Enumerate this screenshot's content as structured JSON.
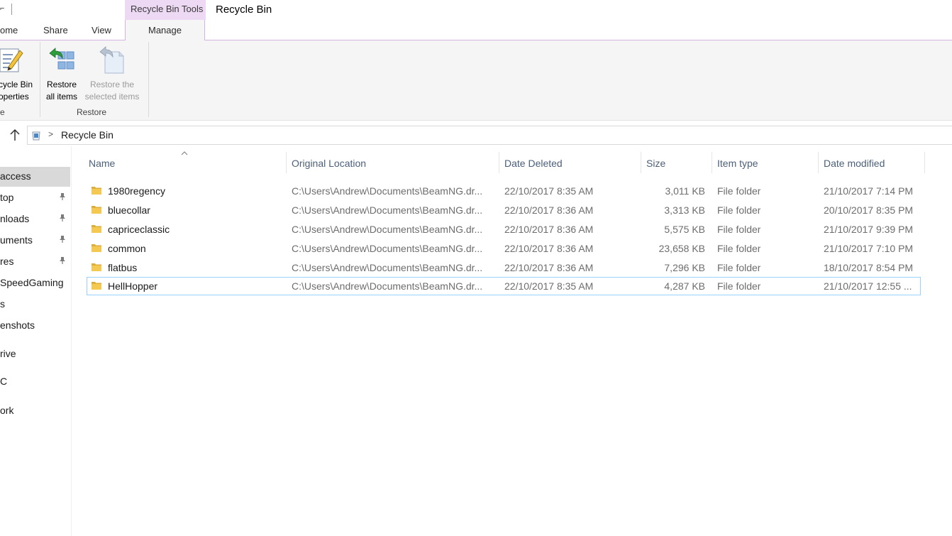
{
  "titlebar": {
    "context_tab_label": "Recycle Bin Tools",
    "window_title": "Recycle Bin"
  },
  "tabs": [
    {
      "label": "ome"
    },
    {
      "label": "Share"
    },
    {
      "label": "View"
    },
    {
      "label": "Manage"
    }
  ],
  "ribbon": {
    "properties_line1": "cycle Bin",
    "properties_line2": "operties",
    "restore_all_line1": "Restore",
    "restore_all_line2": "all items",
    "restore_selected_line1": "Restore the",
    "restore_selected_line2": "selected items",
    "group_left_label": "e",
    "group_restore_label": "Restore"
  },
  "address": {
    "path": "Recycle Bin"
  },
  "nav": {
    "items": [
      {
        "label": "access"
      },
      {
        "label": "top"
      },
      {
        "label": "nloads"
      },
      {
        "label": "uments"
      },
      {
        "label": "res"
      },
      {
        "label": "SpeedGaming"
      },
      {
        "label": "s"
      },
      {
        "label": "enshots"
      },
      {
        "label": "rive"
      },
      {
        "label": "C"
      },
      {
        "label": "ork"
      }
    ]
  },
  "columns": {
    "name": "Name",
    "original_location": "Original Location",
    "date_deleted": "Date Deleted",
    "size": "Size",
    "item_type": "Item type",
    "date_modified": "Date modified"
  },
  "files": [
    {
      "name": "1980regency",
      "location": "C:\\Users\\Andrew\\Documents\\BeamNG.dr...",
      "deleted": "22/10/2017 8:35 AM",
      "size": "3,011 KB",
      "type": "File folder",
      "modified": "21/10/2017 7:14 PM"
    },
    {
      "name": "bluecollar",
      "location": "C:\\Users\\Andrew\\Documents\\BeamNG.dr...",
      "deleted": "22/10/2017 8:36 AM",
      "size": "3,313 KB",
      "type": "File folder",
      "modified": "20/10/2017 8:35 PM"
    },
    {
      "name": "capriceclassic",
      "location": "C:\\Users\\Andrew\\Documents\\BeamNG.dr...",
      "deleted": "22/10/2017 8:36 AM",
      "size": "5,575 KB",
      "type": "File folder",
      "modified": "21/10/2017 9:39 PM"
    },
    {
      "name": "common",
      "location": "C:\\Users\\Andrew\\Documents\\BeamNG.dr...",
      "deleted": "22/10/2017 8:36 AM",
      "size": "23,658 KB",
      "type": "File folder",
      "modified": "21/10/2017 7:10 PM"
    },
    {
      "name": "flatbus",
      "location": "C:\\Users\\Andrew\\Documents\\BeamNG.dr...",
      "deleted": "22/10/2017 8:36 AM",
      "size": "7,296 KB",
      "type": "File folder",
      "modified": "18/10/2017 8:54 PM"
    },
    {
      "name": "HellHopper",
      "location": "C:\\Users\\Andrew\\Documents\\BeamNG.dr...",
      "deleted": "22/10/2017 8:35 AM",
      "size": "4,287 KB",
      "type": "File folder",
      "modified": "21/10/2017 12:55 ..."
    }
  ],
  "colors": {
    "context_tab": "#eed9f5",
    "selection_border": "#99d1ff",
    "folder": "#e8b83e"
  },
  "icons": {
    "properties": "recycle-bin-properties-icon",
    "restore_all": "restore-all-icon",
    "restore_selected": "restore-selected-icon",
    "folder": "folder-icon",
    "up": "up-arrow-icon",
    "pin": "pin-icon"
  }
}
